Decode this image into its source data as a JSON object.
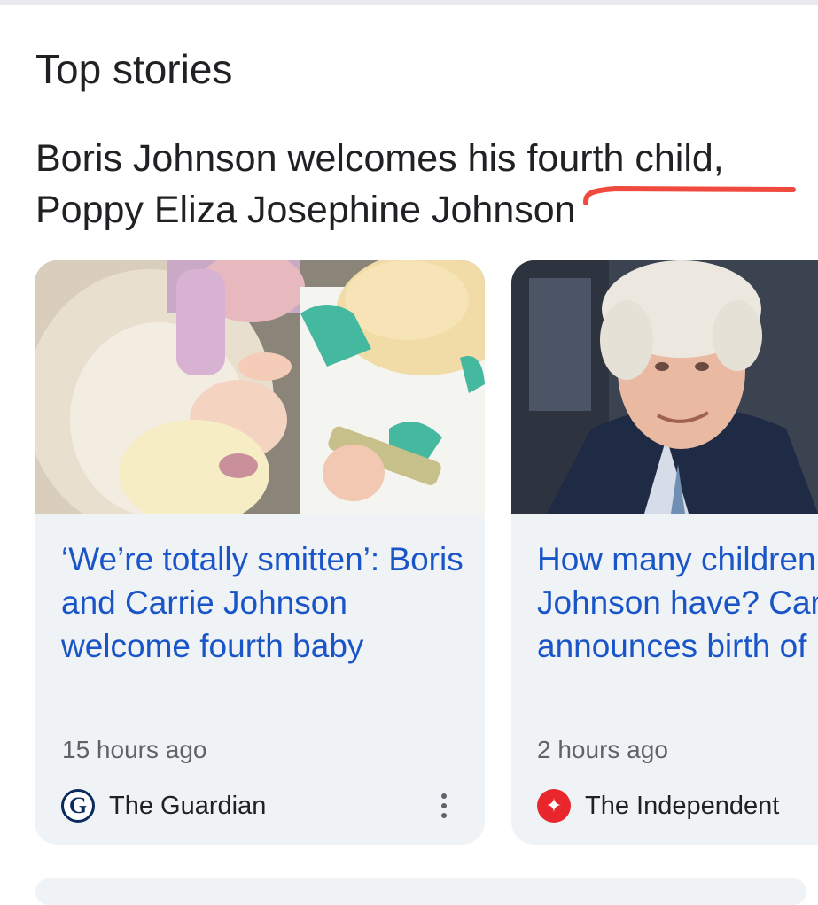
{
  "section": {
    "title": "Top stories"
  },
  "headline": {
    "text": "Boris Johnson welcomes his fourth child, Poppy Eliza Josephine Johnson"
  },
  "cards": [
    {
      "title": "‘We’re totally smitten’: Boris and Carrie Johnson welcome fourth baby",
      "time": "15 hours ago",
      "source": "The Guardian",
      "logo": "G",
      "more_icon": "more-vert-icon"
    },
    {
      "title": "How many children does Boris Johnson have? Carrie Johnson announces birth of",
      "time": "2 hours ago",
      "source": "The Independent",
      "logo": "eagle-icon"
    }
  ],
  "colors": {
    "link": "#1a55c8",
    "annotation": "#f04a3f",
    "card_bg": "#f0f3f6"
  }
}
